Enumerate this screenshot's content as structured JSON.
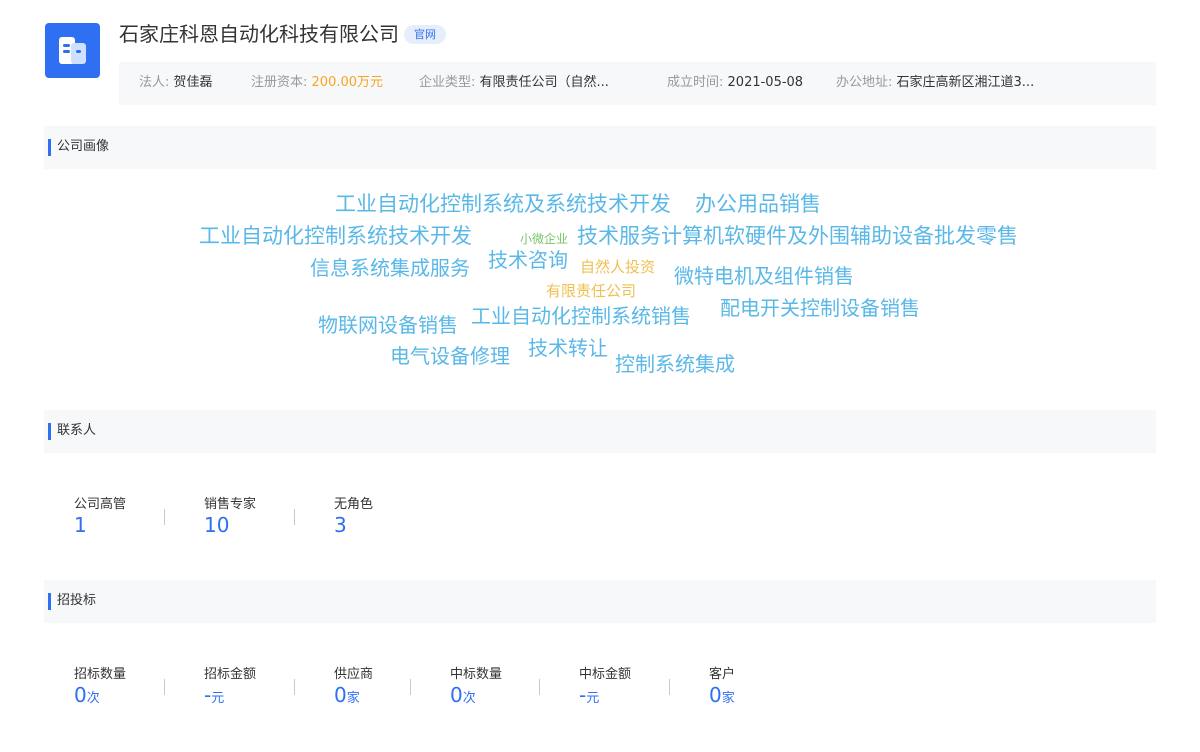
{
  "company": {
    "name": "石家庄科恩自动化科技有限公司",
    "site_tag": "官网"
  },
  "info": [
    {
      "label": "法人:",
      "value": "贺佳磊"
    },
    {
      "label": "注册资本:",
      "value": "200.00万元"
    },
    {
      "label": "企业类型:",
      "value": "有限责任公司（自然..."
    },
    {
      "label": "成立时间:",
      "value": "2021-05-08"
    },
    {
      "label": "办公地址:",
      "value": "石家庄高新区湘江道3..."
    }
  ],
  "portrait": {
    "title": "公司画像",
    "words": [
      {
        "text": "工业自动化控制系统及系统技术开发",
        "color": "#5ab8e8"
      },
      {
        "text": "办公用品销售",
        "color": "#5ab8e8"
      },
      {
        "text": "工业自动化控制系统技术开发",
        "color": "#5ab8e8"
      },
      {
        "text": "小微企业",
        "color": "#7ac46a"
      },
      {
        "text": "技术服务计算机软硬件及外围辅助设备批发零售",
        "color": "#5ab8e8"
      },
      {
        "text": "信息系统集成服务",
        "color": "#5ab8e8"
      },
      {
        "text": "技术咨询",
        "color": "#5ab8e8"
      },
      {
        "text": "自然人投资",
        "color": "#f0c050"
      },
      {
        "text": "微特电机及组件销售",
        "color": "#5ab8e8"
      },
      {
        "text": "有限责任公司",
        "color": "#f0c050"
      },
      {
        "text": "物联网设备销售",
        "color": "#5ab8e8"
      },
      {
        "text": "工业自动化控制系统销售",
        "color": "#5ab8e8"
      },
      {
        "text": "配电开关控制设备销售",
        "color": "#5ab8e8"
      },
      {
        "text": "电气设备修理",
        "color": "#5ab8e8"
      },
      {
        "text": "技术转让",
        "color": "#5ab8e8"
      },
      {
        "text": "控制系统集成",
        "color": "#5ab8e8"
      }
    ]
  },
  "contacts": {
    "title": "联系人",
    "stats": [
      {
        "label": "公司高管",
        "value": "1",
        "unit": ""
      },
      {
        "label": "销售专家",
        "value": "10",
        "unit": ""
      },
      {
        "label": "无角色",
        "value": "3",
        "unit": ""
      }
    ]
  },
  "bidding": {
    "title": "招投标",
    "stats": [
      {
        "label": "招标数量",
        "value": "0",
        "unit": "次"
      },
      {
        "label": "招标金额",
        "value": "-",
        "unit": "元"
      },
      {
        "label": "供应商",
        "value": "0",
        "unit": "家"
      },
      {
        "label": "中标数量",
        "value": "0",
        "unit": "次"
      },
      {
        "label": "中标金额",
        "value": "-",
        "unit": "元"
      },
      {
        "label": "客户",
        "value": "0",
        "unit": "家"
      }
    ]
  },
  "colors": {
    "accent": "#2f6ff2",
    "money": "#f5a623"
  }
}
